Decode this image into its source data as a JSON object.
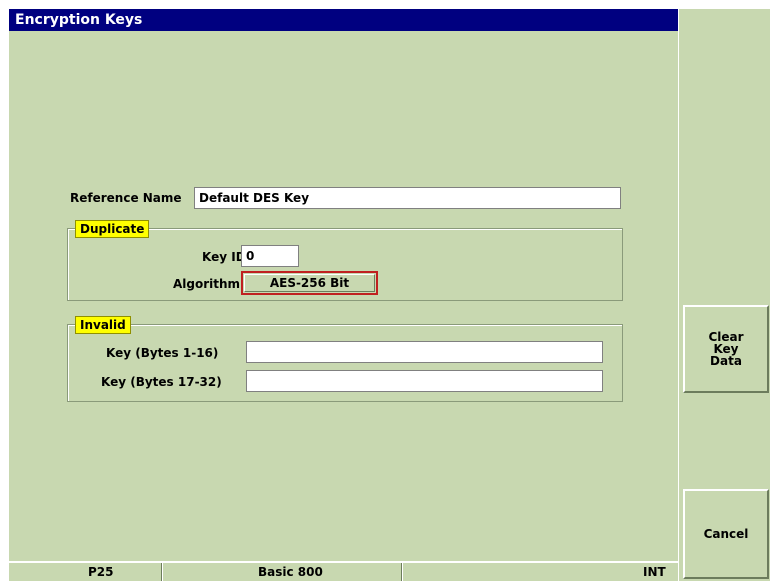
{
  "window": {
    "title": "Encryption Keys"
  },
  "form": {
    "reference_name_label": "Reference Name",
    "reference_name_value": "Default DES Key",
    "duplicate_group": {
      "tag": "Duplicate",
      "key_id_label": "Key ID",
      "key_id_value": "0",
      "algorithm_label": "Algorithm",
      "algorithm_value": "AES-256 Bit"
    },
    "invalid_group": {
      "tag": "Invalid",
      "key1_label": "Key (Bytes 1-16)",
      "key1_value": "",
      "key2_label": "Key (Bytes 17-32)",
      "key2_value": ""
    }
  },
  "softkeys": {
    "clear_key_data": "Clear\nKey\nData",
    "cancel": "Cancel"
  },
  "statusbar": {
    "mode": "P25",
    "profile": "Basic 800",
    "reference": "INT"
  },
  "colors": {
    "background": "#c8d8b0",
    "titlebar": "#000080",
    "group_tag": "#ffff00",
    "selected_border": "#c02020"
  }
}
